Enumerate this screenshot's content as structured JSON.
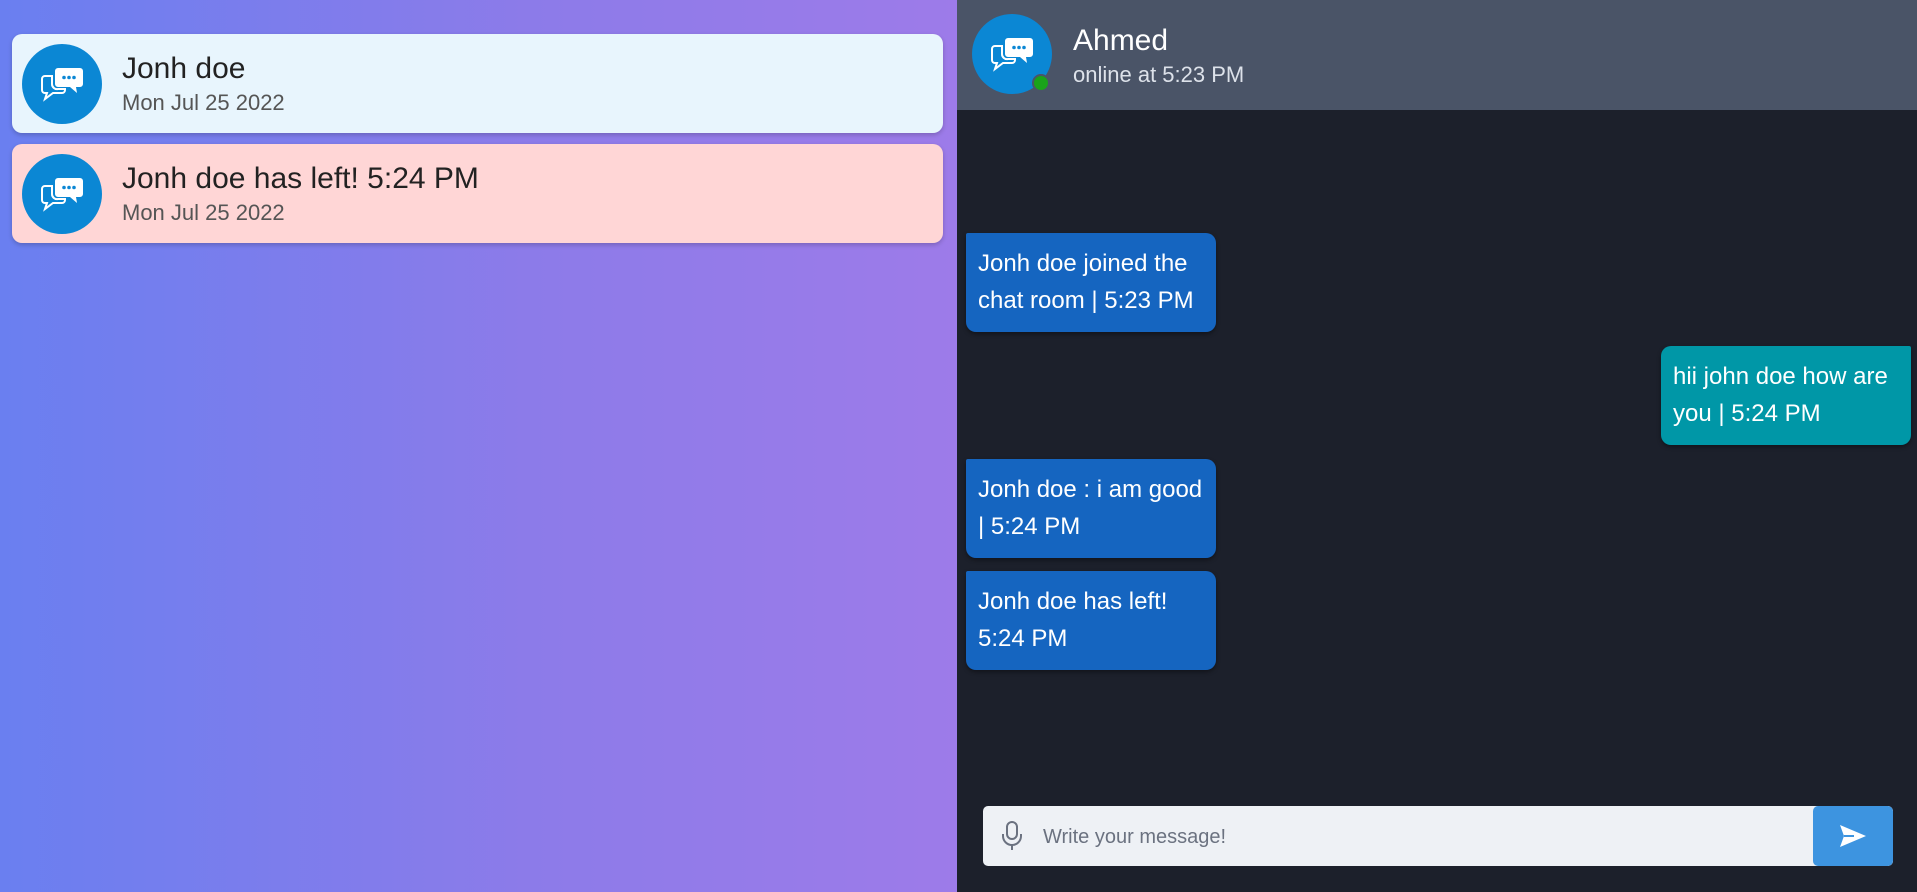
{
  "colors": {
    "avatar": "#0b87d4",
    "card_joined_bg": "#e8f5fd",
    "card_left_bg": "#ffd6d6",
    "incoming_bubble": "#1565c0",
    "outgoing_bubble": "#0097a7",
    "online": "#1aa31a",
    "send_button": "#3d94e0"
  },
  "sidebar": {
    "items": [
      {
        "icon": "chat-bubbles-icon",
        "title": "Jonh doe",
        "date": "Mon Jul 25 2022"
      },
      {
        "icon": "chat-bubbles-icon",
        "title": "Jonh doe has left! 5:24 PM",
        "date": "Mon Jul 25 2022"
      }
    ]
  },
  "chat": {
    "header": {
      "icon": "chat-bubbles-icon",
      "name": "Ahmed",
      "status": "online at 5:23 PM"
    },
    "messages": [
      {
        "direction": "incoming",
        "text": "Jonh doe joined the chat room | 5:23 PM"
      },
      {
        "direction": "outgoing",
        "text": "hii john doe how are you | 5:24 PM"
      },
      {
        "direction": "incoming",
        "text": "Jonh doe : i am good | 5:24 PM"
      },
      {
        "direction": "incoming",
        "text": "Jonh doe has left! 5:24 PM"
      }
    ],
    "composer": {
      "mic_icon": "microphone-icon",
      "placeholder": "Write your message!",
      "value": "",
      "send_icon": "paper-plane-icon"
    }
  }
}
